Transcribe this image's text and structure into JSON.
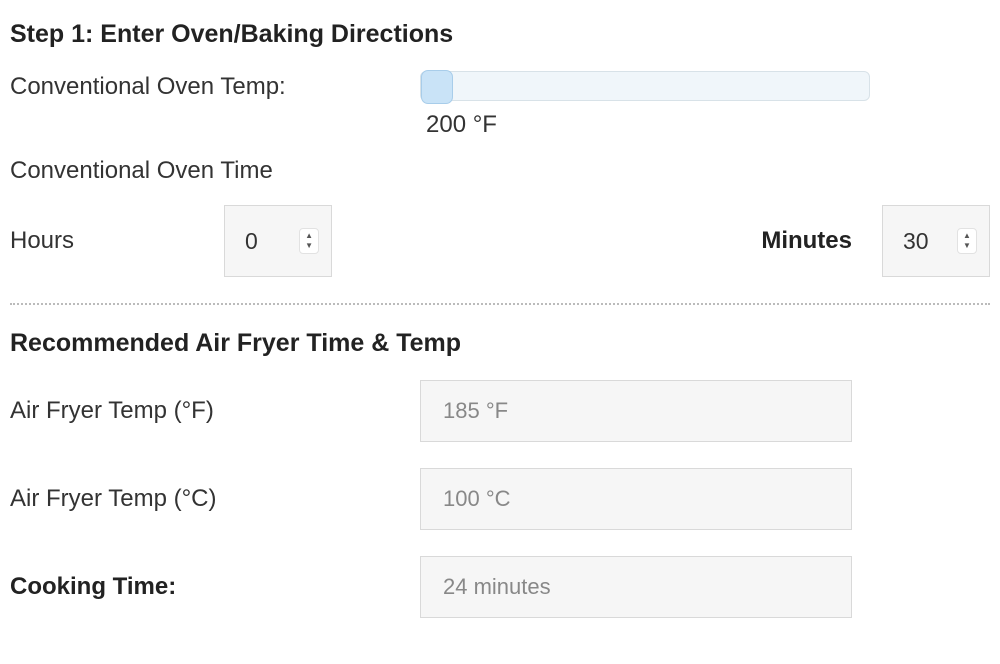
{
  "step1": {
    "title": "Step 1: Enter Oven/Baking Directions",
    "oven_temp_label": "Conventional Oven Temp:",
    "oven_temp_value": "200 °F",
    "oven_time_heading": "Conventional Oven Time",
    "hours_label": "Hours",
    "hours_value": "0",
    "minutes_label": "Minutes",
    "minutes_value": "30"
  },
  "results": {
    "title": "Recommended Air Fryer Time & Temp",
    "temp_f_label": "Air Fryer Temp (°F)",
    "temp_f_value": "185 °F",
    "temp_c_label": "Air Fryer Temp (°C)",
    "temp_c_value": "100 °C",
    "cooking_time_label": "Cooking Time:",
    "cooking_time_value": "24 minutes"
  }
}
